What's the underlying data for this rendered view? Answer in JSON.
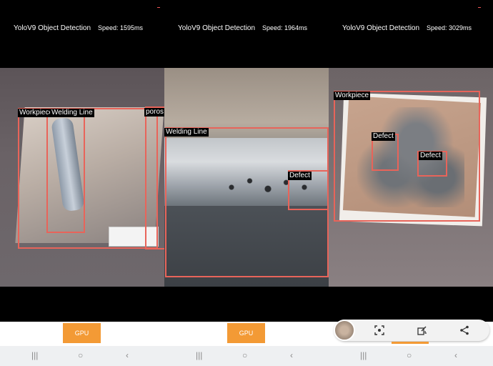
{
  "panels": [
    {
      "title": "YoloV9 Object Detection",
      "speed": "Speed:  1595ms",
      "labels": {
        "workpiece": "Workpiece",
        "welding_line": "Welding Line",
        "porosity": "poros"
      },
      "gpu_label": "GPU"
    },
    {
      "title": "YoloV9 Object Detection",
      "speed": "Speed:  1964ms",
      "labels": {
        "welding_line": "Welding Line",
        "defect": "Defect"
      },
      "gpu_label": "GPU"
    },
    {
      "title": "YoloV9 Object Detection",
      "speed": "Speed:  3029ms",
      "labels": {
        "workpiece": "Workpiece",
        "defect1": "Defect",
        "defect2": "Defect"
      }
    }
  ],
  "nav": {
    "recents": "|||",
    "home": "○",
    "back": "‹"
  },
  "toolbar": {
    "icons": [
      "thumbnail-icon",
      "scan-text-icon",
      "edit-icon",
      "share-icon"
    ]
  },
  "colors": {
    "bbox": "#e8645a",
    "gpu": "#f39a35"
  }
}
